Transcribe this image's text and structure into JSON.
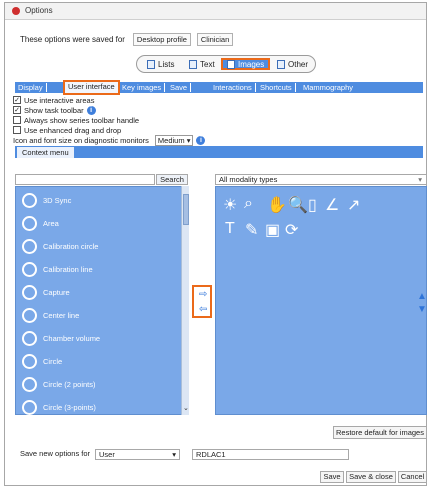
{
  "window": {
    "title": "Options"
  },
  "saved_for": {
    "label": "These options were saved for",
    "options": [
      "Desktop profile",
      "Clinician"
    ]
  },
  "segments": [
    {
      "label": "Lists",
      "icon": "lists-icon",
      "active": false
    },
    {
      "label": "Text",
      "icon": "text-icon",
      "active": false
    },
    {
      "label": "Images",
      "icon": "images-icon",
      "active": true
    },
    {
      "label": "Other",
      "icon": "other-icon",
      "active": false
    }
  ],
  "tabs": [
    "Display",
    "User interface",
    "Key images",
    "Save",
    "Interactions",
    "Shortcuts",
    "Mammography"
  ],
  "options": [
    {
      "label": "Use interactive areas",
      "checked": true
    },
    {
      "label": "Show task toolbar",
      "checked": true
    },
    {
      "label": "Always show series toolbar handle",
      "checked": false
    },
    {
      "label": "Use enhanced drag and drop",
      "checked": false
    }
  ],
  "icon_size": {
    "label": "Icon and font size on diagnostic monitors",
    "value": "Medium"
  },
  "context_menu": {
    "tab": "Context menu",
    "search_button": "Search"
  },
  "context_items": [
    "3D Sync",
    "Area",
    "Calibration circle",
    "Calibration line",
    "Capture",
    "Center line",
    "Chamber volume",
    "Circle",
    "Circle (2 points)",
    "Circle (3-points)"
  ],
  "modality": {
    "selected": "All modality types"
  },
  "restore_button": "Restore default for images",
  "save_new": {
    "label": "Save new options for",
    "user_value": "User",
    "name_value": "RDLAC1"
  },
  "buttons": {
    "save": "Save",
    "save_close": "Save & close",
    "cancel": "Cancel"
  }
}
